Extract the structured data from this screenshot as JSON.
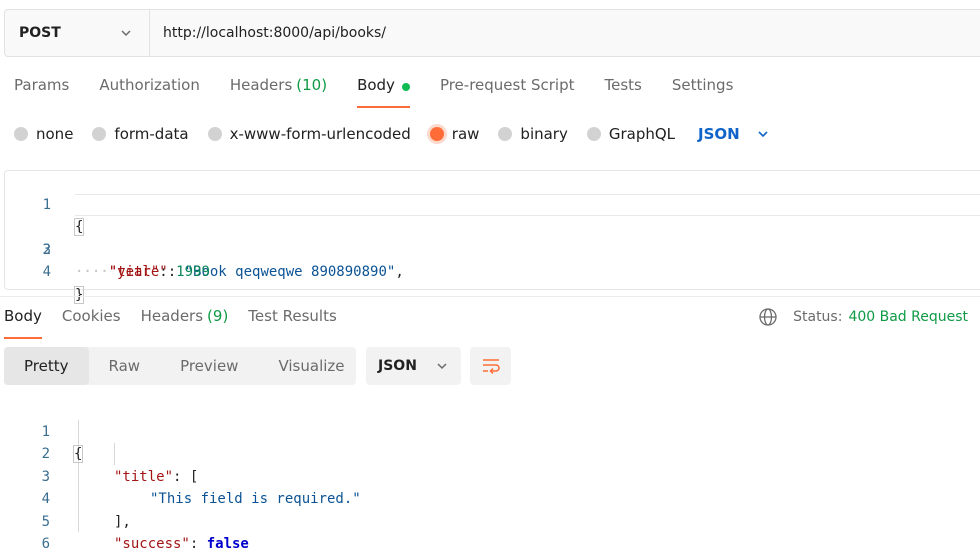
{
  "request": {
    "method": "POST",
    "url": "http://localhost:8000/api/books/"
  },
  "request_tabs": [
    {
      "label": "Params"
    },
    {
      "label": "Authorization"
    },
    {
      "label": "Headers",
      "count": "(10)"
    },
    {
      "label": "Body",
      "active": true
    },
    {
      "label": "Pre-request Script"
    },
    {
      "label": "Tests"
    },
    {
      "label": "Settings"
    }
  ],
  "body_types": [
    {
      "label": "none"
    },
    {
      "label": "form-data"
    },
    {
      "label": "x-www-form-urlencoded"
    },
    {
      "label": "raw",
      "selected": true
    },
    {
      "label": "binary"
    },
    {
      "label": "GraphQL"
    }
  ],
  "body_format": "JSON",
  "request_body": {
    "line_numbers": [
      "1",
      "2",
      "3",
      "4"
    ],
    "key_title": "\"title\"",
    "value_title": "\"Book qeqweqwe 890890890\"",
    "key_year": "\"year\"",
    "value_year": "1999"
  },
  "response_tabs": [
    {
      "label": "Body",
      "active": true
    },
    {
      "label": "Cookies"
    },
    {
      "label": "Headers",
      "count": "(9)"
    },
    {
      "label": "Test Results"
    }
  ],
  "status": {
    "label": "Status:",
    "value": "400 Bad Request"
  },
  "view_modes": [
    "Pretty",
    "Raw",
    "Preview",
    "Visualize"
  ],
  "response_format": "JSON",
  "response_body": {
    "line_numbers": [
      "1",
      "2",
      "3",
      "4",
      "5",
      "6"
    ],
    "key_title": "\"title\"",
    "message": "\"This field is required.\"",
    "key_success": "\"success\"",
    "value_success": "false"
  },
  "colors": {
    "accent": "#ff6c37",
    "success": "#0f9a45",
    "link": "#1064c9"
  },
  "icons": [
    "chevron-down-icon",
    "globe-icon",
    "wrap-lines-icon"
  ]
}
